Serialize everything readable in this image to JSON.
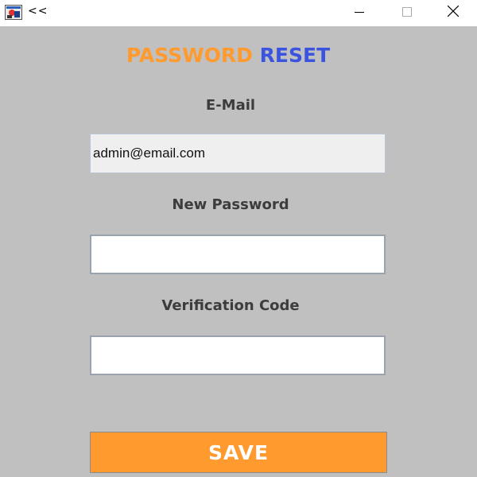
{
  "window": {
    "title": "<<",
    "icon": "java-app-icon",
    "controls": [
      "minimize-icon",
      "maximize-icon",
      "close-icon"
    ]
  },
  "form": {
    "heading_part1": "PASSWORD",
    "heading_part2": "RESET",
    "email_label": "E-Mail",
    "email_value": "admin@email.com",
    "new_password_label": "New Password",
    "new_password_value": "",
    "verification_code_label": "Verification Code",
    "verification_code_value": "",
    "save_label": "SAVE"
  },
  "colors": {
    "background": "#c0c0c0",
    "accent_orange": "#ff9a2e",
    "accent_blue": "#3b54e0",
    "label_text": "#3c3c3c"
  }
}
